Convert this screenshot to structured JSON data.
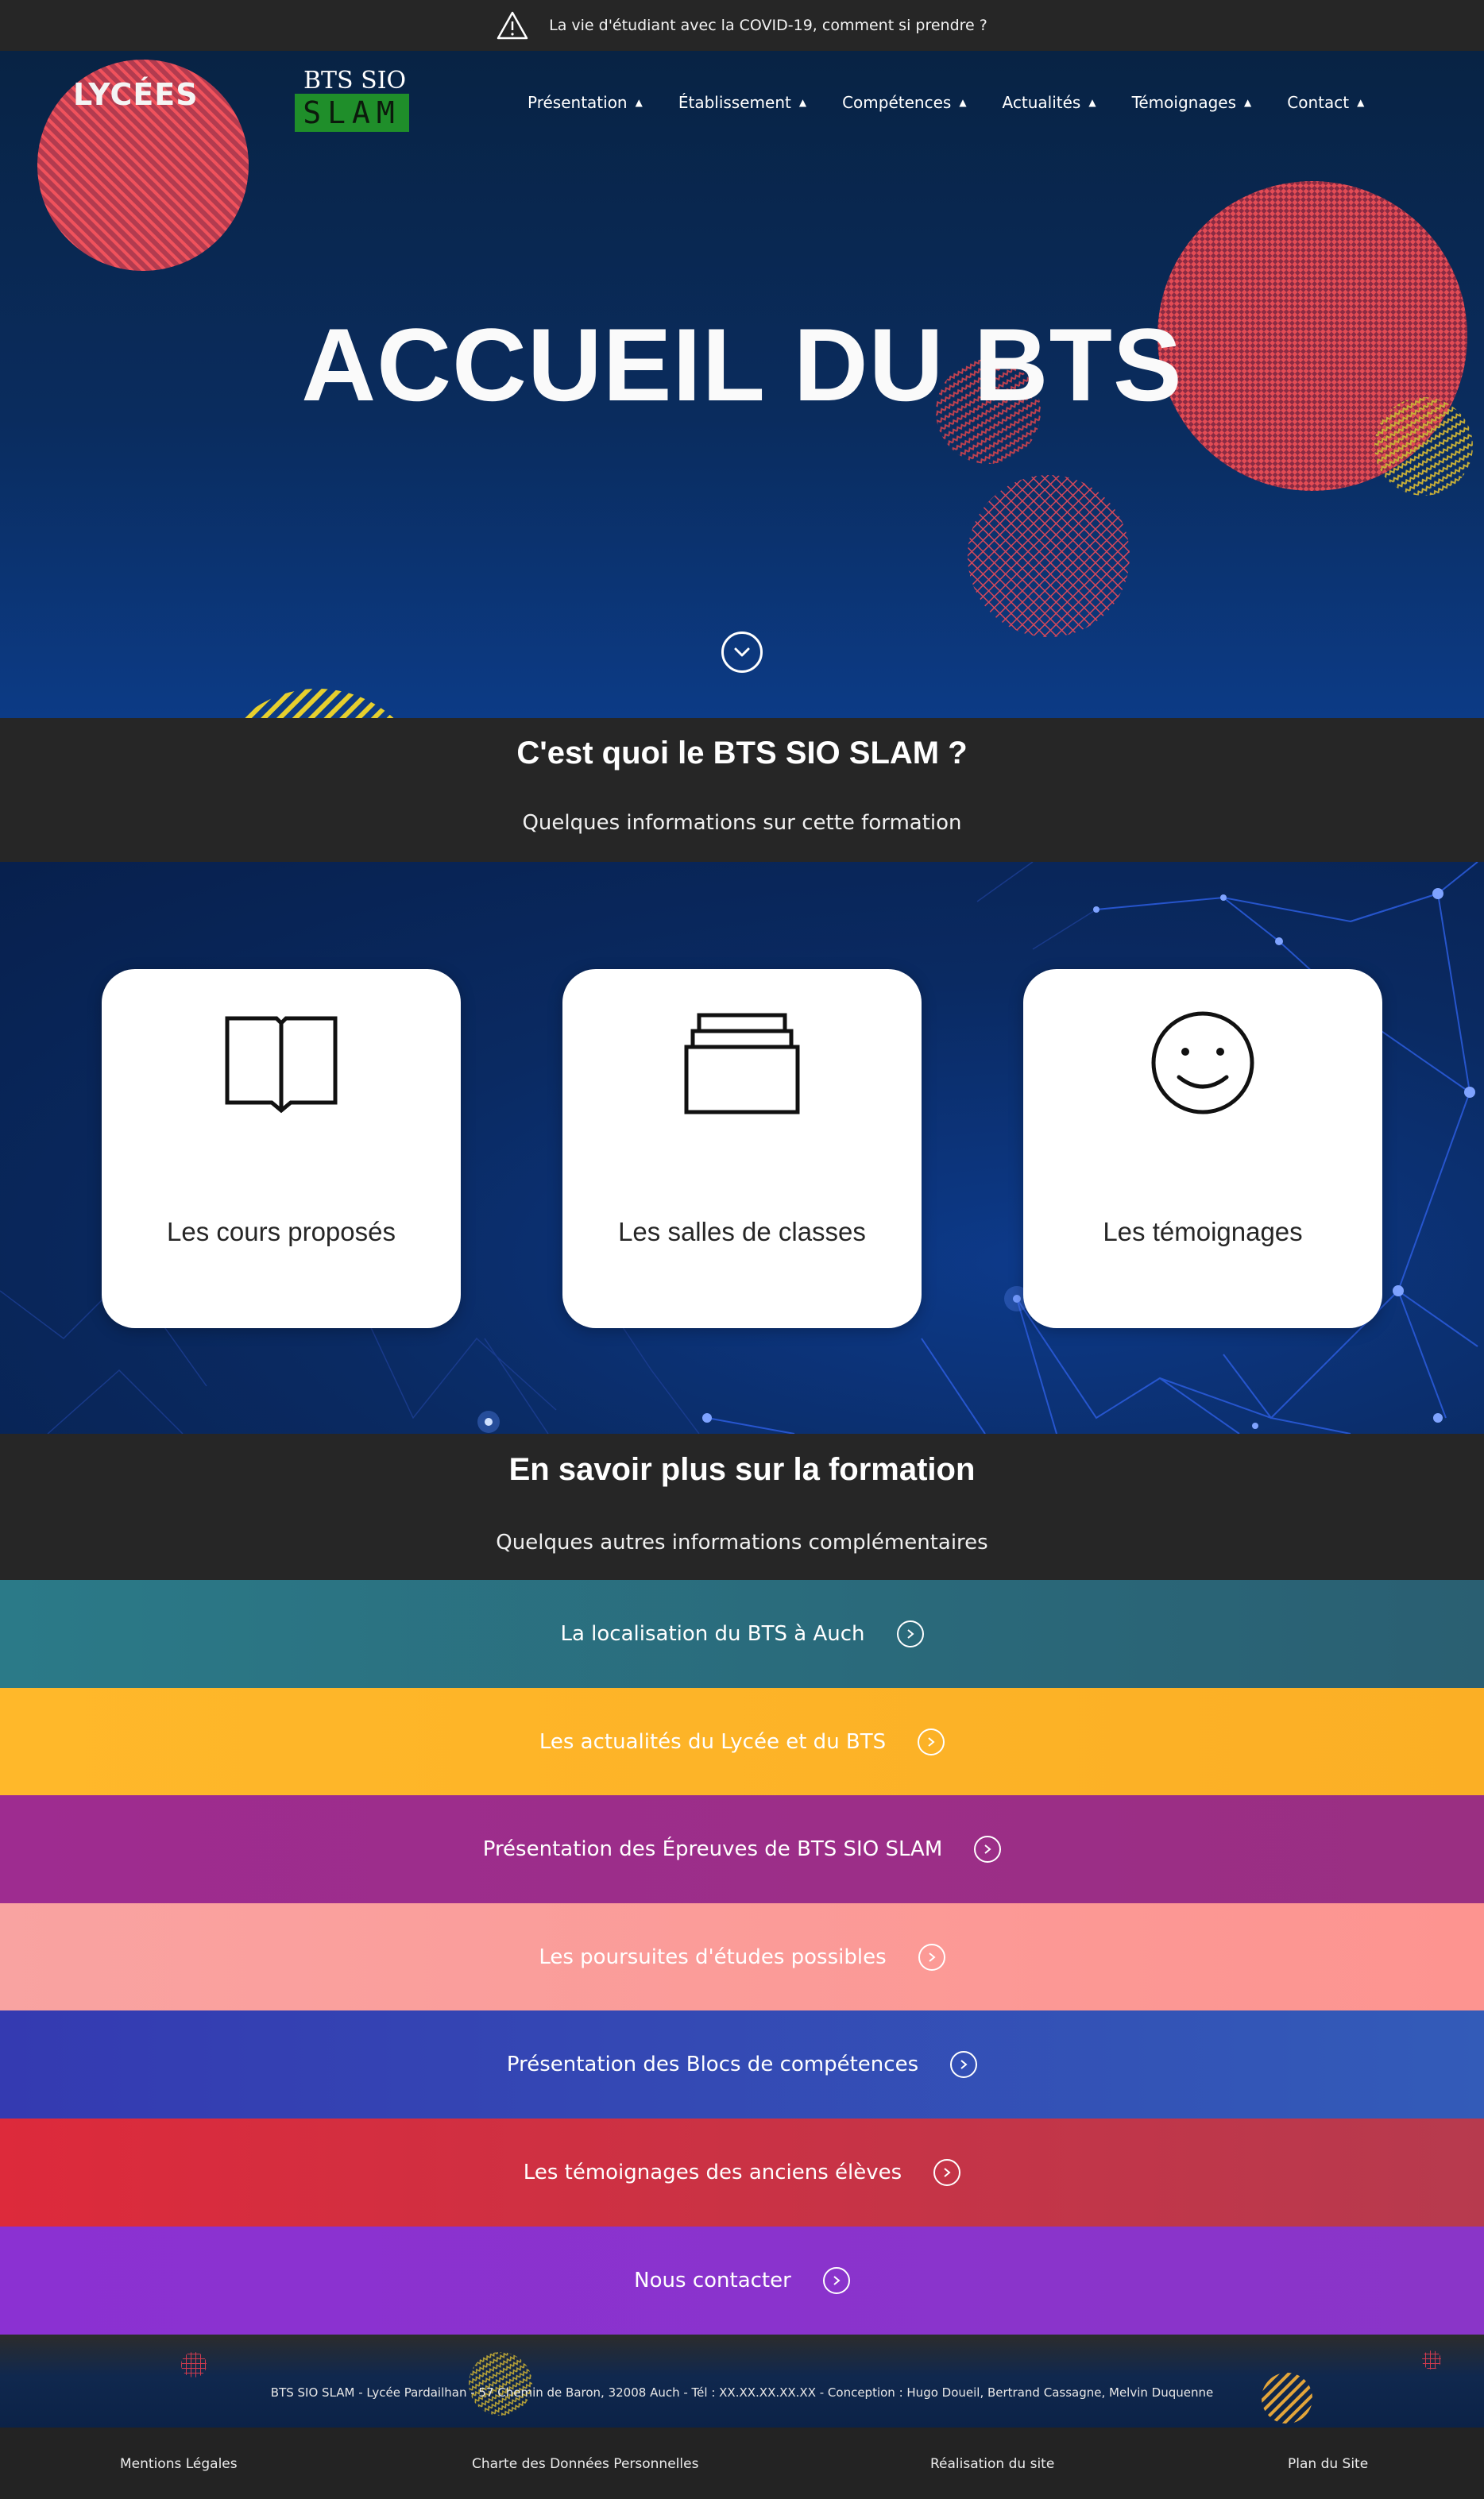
{
  "alert": {
    "icon": "warning-icon",
    "text": "La vie d'étudiant avec la COVID-19, comment si prendre ?"
  },
  "header": {
    "logo_lycees": "LYCÉES",
    "logo_bts": "BTS SIO",
    "logo_slam": "SLAM",
    "nav": [
      {
        "label": "Présentation"
      },
      {
        "label": "Établissement"
      },
      {
        "label": "Compétences"
      },
      {
        "label": "Actualités"
      },
      {
        "label": "Témoignages"
      },
      {
        "label": "Contact"
      }
    ]
  },
  "hero": {
    "title": "ACCUEIL DU BTS",
    "scroll_icon": "chevron-down-icon"
  },
  "intro": {
    "title": "C'est quoi le BTS SIO SLAM ?",
    "subtitle": "Quelques informations sur cette formation"
  },
  "cards": [
    {
      "label": "Les cours proposés",
      "icon": "open-book-icon"
    },
    {
      "label": "Les salles de classes",
      "icon": "stacked-trays-icon"
    },
    {
      "label": "Les témoignages",
      "icon": "smiley-icon"
    }
  ],
  "more": {
    "title": "En savoir plus sur la formation",
    "subtitle": "Quelques autres informations complémentaires"
  },
  "links": [
    {
      "label": "La localisation du BTS à Auch",
      "color": "#2d6e7e"
    },
    {
      "label": "Les actualités du Lycée et du BTS",
      "color": "#fdb327"
    },
    {
      "label": "Présentation des Épreuves de BTS SIO SLAM",
      "color": "#a33192"
    },
    {
      "label": "Les poursuites d'études possibles",
      "color": "#f99b9c"
    },
    {
      "label": "Présentation des Blocs de compétences",
      "color": "#3541b4"
    },
    {
      "label": "Les témoignages des anciens élèves",
      "color": "#d92b3d"
    },
    {
      "label": "Nous contacter",
      "color": "#8833cc"
    }
  ],
  "footer": {
    "info": "BTS SIO SLAM - Lycée Pardailhan - 57 Chemin de Baron, 32008 Auch - Tél : XX.XX.XX.XX.XX - Conception : Hugo Doueil, Bertrand Cassagne, Melvin Duquenne",
    "links": [
      "Mentions Légales",
      "Charte des Données Personnelles",
      "Réalisation du site",
      "Plan du Site"
    ]
  }
}
